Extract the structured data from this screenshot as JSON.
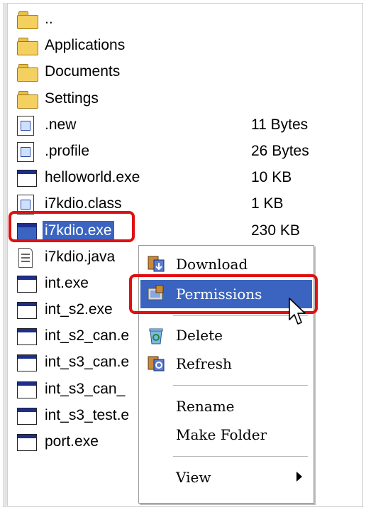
{
  "files": [
    {
      "name": "..",
      "size": "",
      "icon": "folder-icon"
    },
    {
      "name": "Applications",
      "size": "",
      "icon": "folder-icon"
    },
    {
      "name": "Documents",
      "size": "",
      "icon": "folder-icon"
    },
    {
      "name": "Settings",
      "size": "",
      "icon": "folder-icon"
    },
    {
      "name": ".new",
      "size": "11 Bytes",
      "icon": "file-icon"
    },
    {
      "name": ".profile",
      "size": "26 Bytes",
      "icon": "file-icon"
    },
    {
      "name": "helloworld.exe",
      "size": "10 KB",
      "icon": "executable-icon"
    },
    {
      "name": "i7kdio.class",
      "size": "1 KB",
      "icon": "file-icon"
    },
    {
      "name": "i7kdio.exe",
      "size": "230 KB",
      "icon": "executable-icon",
      "selected": true
    },
    {
      "name": "i7kdio.java",
      "size": "",
      "icon": "text-file-icon"
    },
    {
      "name": "int.exe",
      "size": "",
      "icon": "executable-icon"
    },
    {
      "name": "int_s2.exe",
      "size": "",
      "icon": "executable-icon"
    },
    {
      "name": "int_s2_can.e",
      "size": "",
      "icon": "executable-icon"
    },
    {
      "name": "int_s3_can.e",
      "size": "",
      "icon": "executable-icon"
    },
    {
      "name": "int_s3_can_",
      "size": "",
      "icon": "executable-icon"
    },
    {
      "name": "int_s3_test.e",
      "size": "",
      "icon": "executable-icon"
    },
    {
      "name": "port.exe",
      "size": "",
      "icon": "executable-icon"
    }
  ],
  "context_menu": {
    "download": "Download",
    "permissions": "Permissions",
    "delete": "Delete",
    "refresh": "Refresh",
    "rename": "Rename",
    "make_folder": "Make Folder",
    "view": "View"
  },
  "colors": {
    "highlight": "#3a64c0",
    "annotation": "#e01010"
  }
}
